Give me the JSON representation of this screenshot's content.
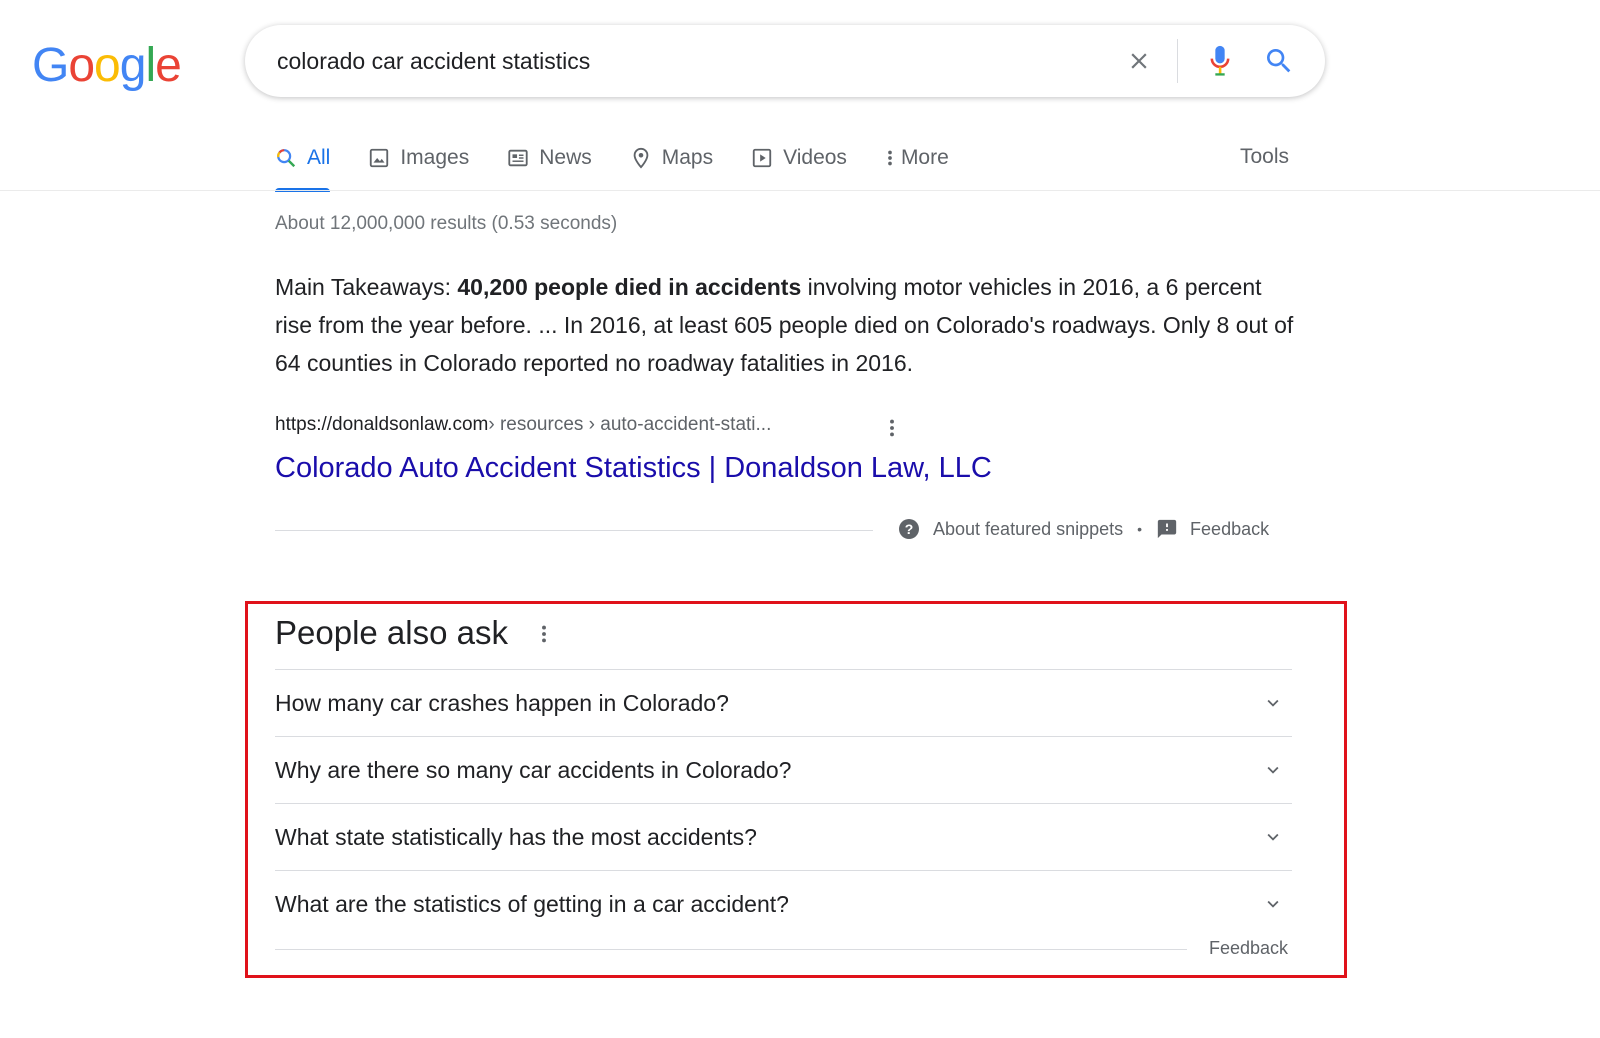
{
  "logo": {
    "letters": [
      {
        "ch": "G",
        "color": "#4285F4"
      },
      {
        "ch": "o",
        "color": "#EA4335"
      },
      {
        "ch": "o",
        "color": "#FBBC05"
      },
      {
        "ch": "g",
        "color": "#4285F4"
      },
      {
        "ch": "l",
        "color": "#34A853"
      },
      {
        "ch": "e",
        "color": "#EA4335"
      }
    ]
  },
  "search": {
    "query": "colorado car accident statistics",
    "clear_icon": "close-icon",
    "mic_icon": "mic-icon",
    "search_icon": "search-icon"
  },
  "tabs": [
    {
      "label": "All",
      "icon": "search-icon",
      "active": true
    },
    {
      "label": "Images",
      "icon": "image-icon"
    },
    {
      "label": "News",
      "icon": "news-icon"
    },
    {
      "label": "Maps",
      "icon": "map-pin-icon"
    },
    {
      "label": "Videos",
      "icon": "video-icon"
    },
    {
      "label": "More",
      "icon": "more-vert-icon"
    }
  ],
  "tools_label": "Tools",
  "result_stats": "About 12,000,000 results (0.53 seconds)",
  "snippet": {
    "prefix": "Main Takeaways: ",
    "bold": "40,200 people died in accidents",
    "rest": " involving motor vehicles in 2016, a 6 percent rise from the year before. ... In 2016, at least 605 people died on Colorado's roadways. Only 8 out of 64 counties in Colorado reported no roadway fatalities in 2016.",
    "cite_domain": "https://donaldsonlaw.com",
    "cite_path": " › resources › auto-accident-stati...",
    "title": "Colorado Auto Accident Statistics | Donaldson Law, LLC",
    "about_label": "About featured snippets",
    "separator": "•",
    "feedback_label": "Feedback"
  },
  "paa": {
    "title": "People also ask",
    "questions": [
      "How many car crashes happen in Colorado?",
      "Why are there so many car accidents in Colorado?",
      "What state statistically has the most accidents?",
      "What are the statistics of getting in a car accident?"
    ],
    "feedback_label": "Feedback",
    "highlight_color": "#e0121a"
  },
  "colors": {
    "link": "#1a0dab",
    "accent": "#1a73e8",
    "muted": "#5f6368"
  }
}
